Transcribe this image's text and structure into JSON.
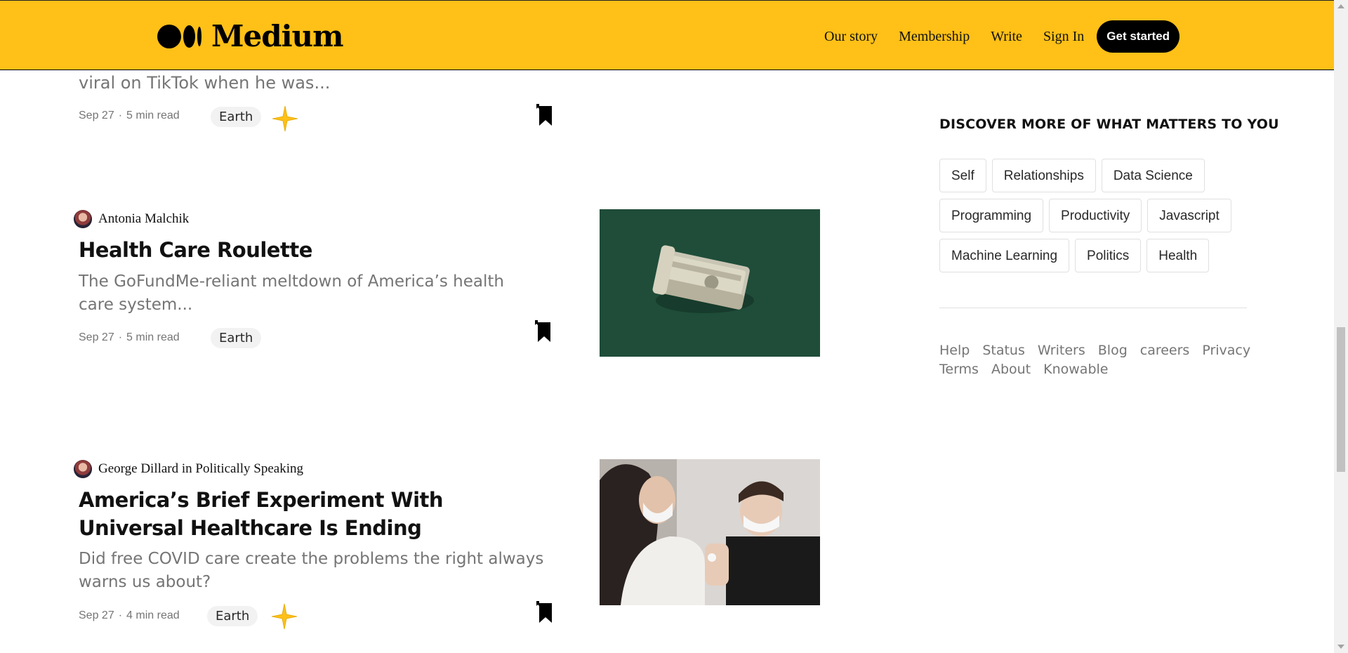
{
  "header": {
    "logo_text": "Medium",
    "nav": [
      "Our story",
      "Membership",
      "Write",
      "Sign In"
    ],
    "cta": "Get started",
    "background": "#FFC017"
  },
  "articles": [
    {
      "excerpt": "viral on TikTok when he was...",
      "date": "Sep 27",
      "read_time": "5 min read",
      "tag": "Earth",
      "member_only": true
    },
    {
      "author": "Antonia Malchik",
      "title": "Health Care Roulette",
      "excerpt": "The GoFundMe-reliant meltdown of America’s health care system...",
      "date": "Sep 27",
      "read_time": "5 min read",
      "tag": "Earth",
      "member_only": false,
      "thumbnail": "folded-dollar-bill-on-green"
    },
    {
      "author": "George Dillard in Politically Speaking",
      "title": "America’s Brief Experiment With Universal Healthcare Is Ending",
      "excerpt": "Did free COVID care create the problems the right always warns us about?",
      "date": "Sep 27",
      "read_time": "4 min read",
      "tag": "Earth",
      "member_only": true,
      "thumbnail": "vaccination-masked-people"
    }
  ],
  "sidebar": {
    "title": "DISCOVER MORE OF WHAT MATTERS TO YOU",
    "topics": [
      "Self",
      "Relationships",
      "Data Science",
      "Programming",
      "Productivity",
      "Javascript",
      "Machine Learning",
      "Politics",
      "Health"
    ],
    "footer_links": [
      "Help",
      "Status",
      "Writers",
      "Blog",
      "careers",
      "Privacy",
      "Terms",
      "About",
      "Knowable"
    ]
  },
  "colors": {
    "accent": "#FFC017",
    "star": "#FFC017",
    "muted": "#757575"
  },
  "icons": {
    "bookmark": "bookmark-icon",
    "star": "member-star-icon"
  }
}
